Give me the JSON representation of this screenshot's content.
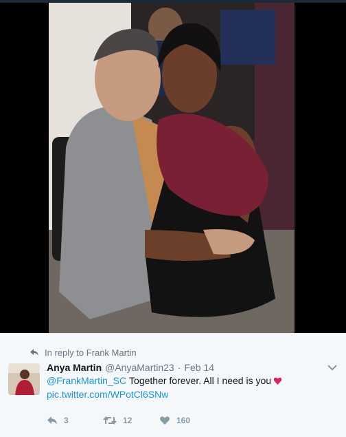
{
  "reply_context": {
    "label": "In reply to Frank Martin"
  },
  "tweet": {
    "display_name": "Anya Martin",
    "handle": "@AnyaMartin23",
    "separator": "·",
    "date": "Feb 14",
    "mention": "@FrankMartin_SC",
    "body_text": "Together forever. All I need is you",
    "emoji": "heart-emoji",
    "link": "pic.twitter.com/WPotCl6SNw"
  },
  "actions": {
    "reply_count": "3",
    "retweet_count": "12",
    "like_count": "160"
  },
  "colors": {
    "link_blue": "#1b95e0",
    "meta_gray": "#657786",
    "action_gray": "#8899a6",
    "card_bg": "#f5f8fa",
    "heart_red": "#e0245e"
  },
  "icons": [
    "reply-arrow-icon",
    "chevron-down-icon",
    "reply-icon",
    "retweet-icon",
    "like-heart-icon",
    "heart-emoji-icon"
  ]
}
